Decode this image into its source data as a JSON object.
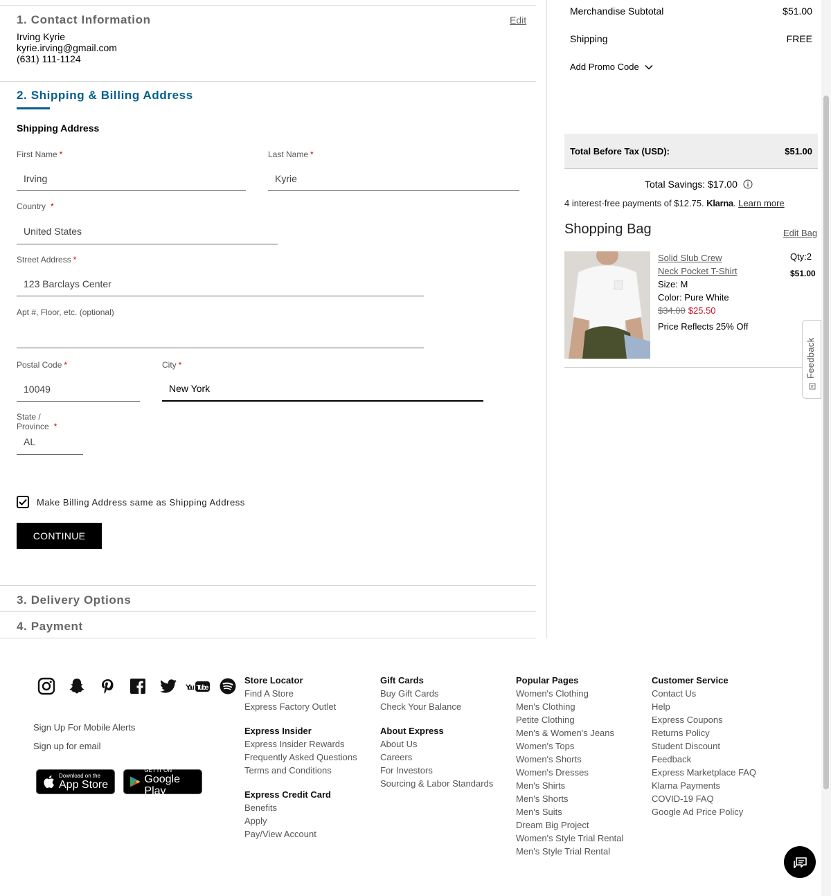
{
  "steps": {
    "contact": {
      "title": "1. Contact Information",
      "edit": "Edit",
      "name": "Irving Kyrie",
      "email": "kyrie.irving@gmail.com",
      "phone": "(631) 111-1124"
    },
    "shipping": {
      "title": "2. Shipping & Billing Address"
    },
    "delivery": {
      "title": "3. Delivery Options"
    },
    "payment": {
      "title": "4. Payment"
    }
  },
  "form": {
    "section_title": "Shipping Address",
    "required_mark": "*",
    "first_name": {
      "label": "First Name",
      "value": "Irving"
    },
    "last_name": {
      "label": "Last Name",
      "value": "Kyrie"
    },
    "country": {
      "label": "Country",
      "value": "United States"
    },
    "street": {
      "label": "Street Address",
      "value": "123 Barclays Center"
    },
    "apt": {
      "label": "Apt #, Floor, etc. (optional)",
      "value": ""
    },
    "postal": {
      "label": "Postal Code",
      "value": "10049"
    },
    "city": {
      "label": "City",
      "value": "New York"
    },
    "state": {
      "label": "State / Province",
      "value": "AL"
    },
    "billing_same": {
      "label": "Make Billing Address same as Shipping Address",
      "checked": true
    },
    "continue_label": "CONTINUE"
  },
  "summary": {
    "merch_label": "Merchandise Subtotal",
    "merch_value": "$51.00",
    "shipping_label": "Shipping",
    "shipping_value": "FREE",
    "promo_label": "Add Promo Code",
    "total_label": "Total Before Tax (USD):",
    "total_value": "$51.00",
    "savings": "Total Savings: $17.00",
    "klarna_text": "4 interest-free payments of $12.75.",
    "klarna_brand": "Klarna",
    "klarna_dot": ".",
    "klarna_link": "Learn more"
  },
  "bag": {
    "title": "Shopping Bag",
    "edit": "Edit Bag",
    "item": {
      "name_line1": "Solid Slub Crew",
      "name_line2": "Neck Pocket T-Shirt",
      "size": "Size: M",
      "color": "Color: Pure White",
      "price_old": "$34.00",
      "price_new": "$25.50",
      "note": "Price Reflects 25% Off",
      "qty": "Qty:2",
      "total": "$51.00"
    }
  },
  "feedback_label": "Feedback",
  "footer": {
    "social_icons": [
      "instagram-icon",
      "snapchat-icon",
      "pinterest-icon",
      "facebook-icon",
      "twitter-icon",
      "youtube-icon",
      "spotify-icon"
    ],
    "youtube_label": "YouTube",
    "mobile_alerts": "Sign Up For Mobile Alerts",
    "email_signup": "Sign up for email",
    "app_store": {
      "small": "Download on the",
      "big": "App Store"
    },
    "google_play": {
      "small": "GET IT ON",
      "big": "Google Play"
    },
    "col1": {
      "store_locator": "Store Locator",
      "find_store": "Find A Store",
      "factory_outlet": "Express Factory Outlet",
      "insider": "Express Insider",
      "insider_rewards": "Express Insider Rewards",
      "faq": "Frequently Asked Questions",
      "terms": "Terms and Conditions",
      "credit_card": "Express Credit Card",
      "benefits": "Benefits",
      "apply": "Apply",
      "pay_view": "Pay/View Account"
    },
    "col2": {
      "gift_cards": "Gift Cards",
      "buy_gift": "Buy Gift Cards",
      "check_balance": "Check Your Balance",
      "about_express": "About Express",
      "about_us": "About Us",
      "careers": "Careers",
      "investors": "For Investors",
      "sourcing": "Sourcing & Labor Standards"
    },
    "col3": {
      "heading": "Popular Pages",
      "links": [
        "Women's Clothing",
        "Men's Clothing",
        "Petite Clothing",
        "Men's & Women's Jeans",
        "Women's Tops",
        "Women's Shorts",
        "Women's Dresses",
        "Men's Shirts",
        "Men's Shorts",
        "Men's Suits",
        "Dream Big Project",
        "Women's Style Trial Rental",
        "Men's Style Trial Rental"
      ]
    },
    "col4": {
      "heading": "Customer Service",
      "links": [
        "Contact Us",
        "Help",
        "Express Coupons",
        "Returns Policy",
        "Student Discount",
        "Feedback",
        "Express Marketplace FAQ",
        "Klarna Payments",
        "COVID-19 FAQ",
        "Google Ad Price Policy"
      ]
    }
  },
  "colors": {
    "accent": "#005f8c",
    "sale": "#c8102e"
  }
}
